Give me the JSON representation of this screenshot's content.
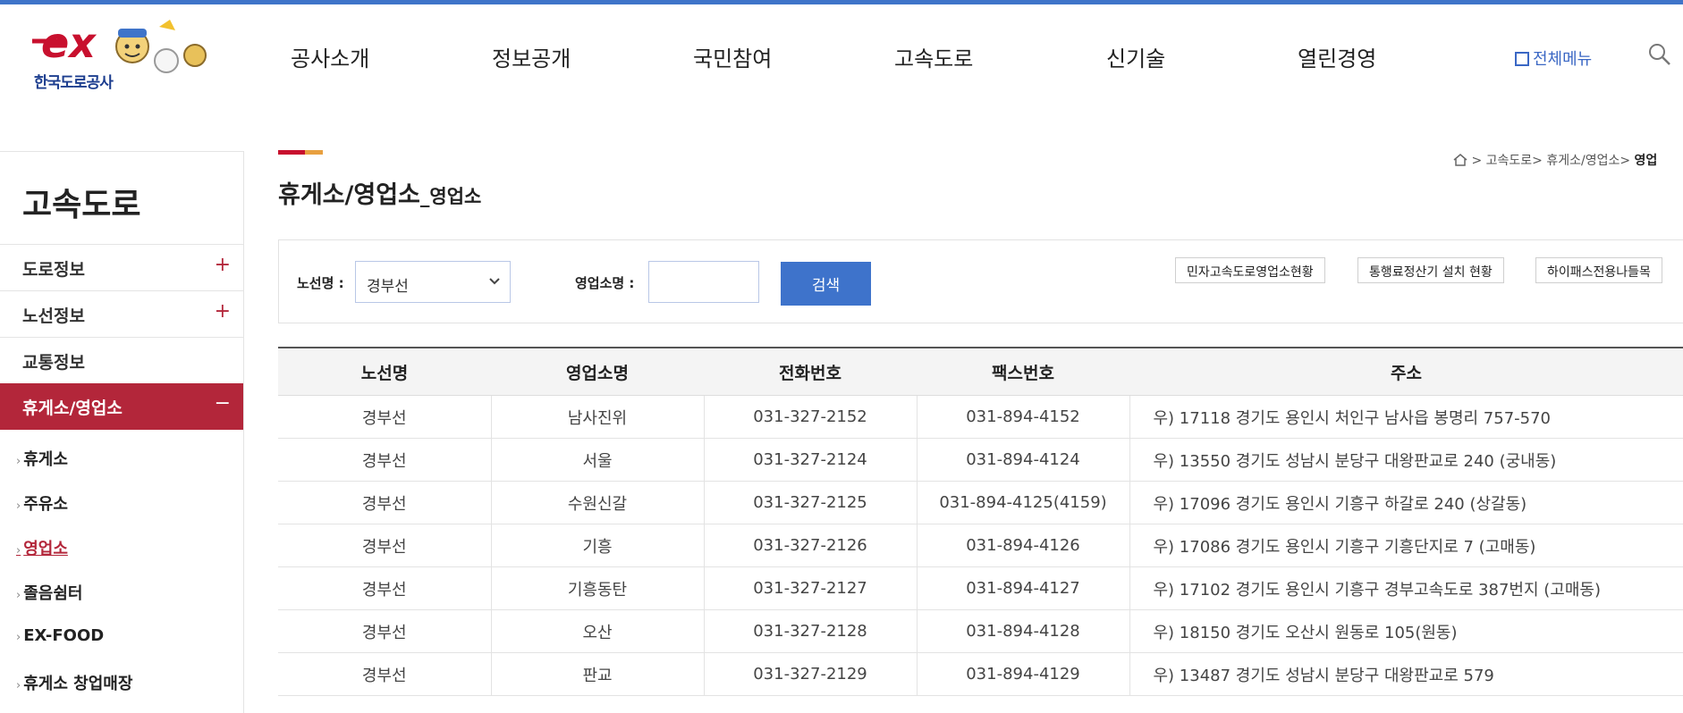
{
  "header": {
    "brand_name": "한국도로공사",
    "gnb": [
      "공사소개",
      "정보공개",
      "국민참여",
      "고속도로",
      "신기술",
      "열린경영"
    ],
    "all_menu_label": "전체메뉴",
    "accent_color": "#3f74c9"
  },
  "lnb": {
    "title": "고속도로",
    "menus": [
      {
        "label": "도로정보",
        "marker": "+"
      },
      {
        "label": "노선정보",
        "marker": "+"
      },
      {
        "label": "교통정보",
        "marker": ""
      },
      {
        "label": "휴게소/영업소",
        "marker": "−"
      }
    ],
    "sub_items": [
      "휴게소",
      "주유소",
      "영업소",
      "졸음쉼터",
      "EX-FOOD",
      "휴게소 창업매장"
    ],
    "sub_arrow": "›",
    "active_color": "#b3263a"
  },
  "page": {
    "title": "휴게소/영업소",
    "title_sep": "_",
    "subtitle": "영업소",
    "breadcrumb": [
      "고속도로",
      "휴게소/영업소",
      "영업"
    ],
    "breadcrumb_sep": ">"
  },
  "search": {
    "route_label": "노선명 :",
    "route_value": "경부선",
    "office_label": "영업소명 :",
    "office_value": "",
    "button": "검색",
    "links": [
      "민자고속도로영업소현황",
      "통행료정산기 설치 현황",
      "하이패스전용나들목"
    ]
  },
  "table": {
    "columns": [
      "노선명",
      "영업소명",
      "전화번호",
      "팩스번호",
      "주소"
    ],
    "rows": [
      [
        "경부선",
        "남사진위",
        "031-327-2152",
        "031-894-4152",
        "우) 17118 경기도 용인시 처인구 남사읍 봉명리 757-570"
      ],
      [
        "경부선",
        "서울",
        "031-327-2124",
        "031-894-4124",
        "우) 13550 경기도 성남시 분당구 대왕판교로 240 (궁내동)"
      ],
      [
        "경부선",
        "수원신갈",
        "031-327-2125",
        "031-894-4125(4159)",
        "우) 17096 경기도 용인시 기흥구 하갈로 240 (상갈동)"
      ],
      [
        "경부선",
        "기흥",
        "031-327-2126",
        "031-894-4126",
        "우) 17086 경기도 용인시 기흥구 기흥단지로 7 (고매동)"
      ],
      [
        "경부선",
        "기흥동탄",
        "031-327-2127",
        "031-894-4127",
        "우) 17102 경기도 용인시 기흥구 경부고속도로 387번지 (고매동)"
      ],
      [
        "경부선",
        "오산",
        "031-327-2128",
        "031-894-4128",
        "우) 18150 경기도 오산시 원동로 105(원동)"
      ],
      [
        "경부선",
        "판교",
        "031-327-2129",
        "031-894-4129",
        "우) 13487 경기도 성남시 분당구 대왕판교로 579"
      ]
    ]
  }
}
